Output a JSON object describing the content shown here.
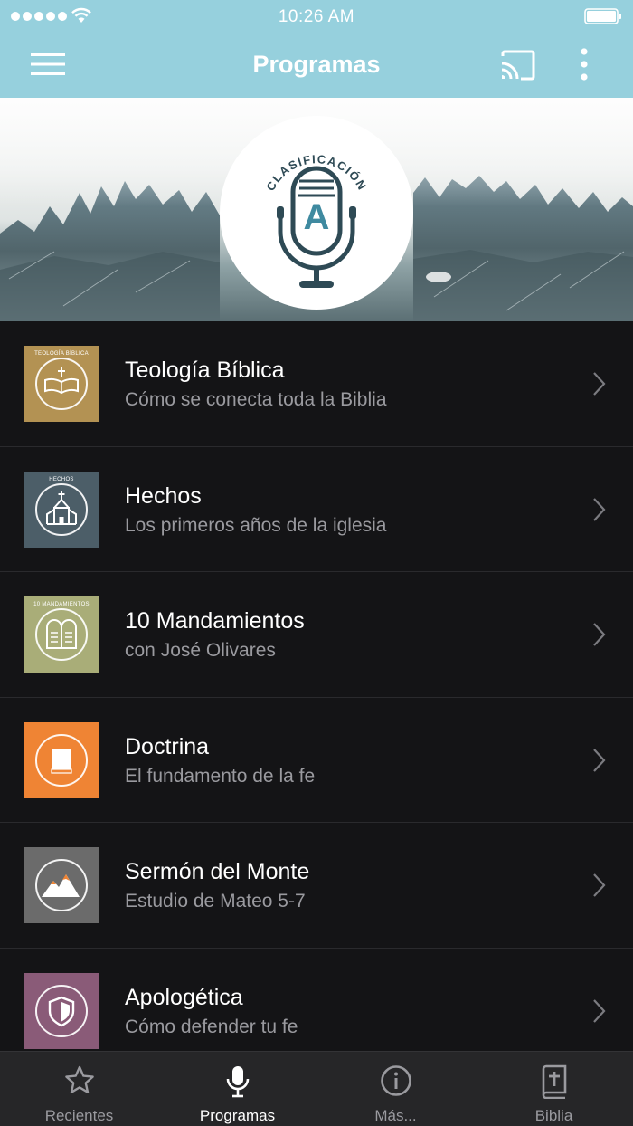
{
  "status_bar": {
    "time": "10:26 AM"
  },
  "nav": {
    "title": "Programas"
  },
  "hero": {
    "logo_text": "CLASIFICACIÓN",
    "logo_letter": "A"
  },
  "programs": [
    {
      "title": "Teología Bíblica",
      "subtitle": "Cómo se conecta toda la Biblia",
      "thumb_caption": "TEOLOGÍA BÍBLICA",
      "icon": "open-bible-icon",
      "color": "#b39253"
    },
    {
      "title": "Hechos",
      "subtitle": "Los primeros años de la iglesia",
      "thumb_caption": "HECHOS",
      "icon": "church-icon",
      "color": "#4c5e68"
    },
    {
      "title": "10 Mandamientos",
      "subtitle": "con José Olivares",
      "thumb_caption": "10 MANDAMIENTOS",
      "icon": "tablets-icon",
      "color": "#a9ad78"
    },
    {
      "title": "Doctrina",
      "subtitle": "El fundamento de la fe",
      "thumb_caption": "",
      "icon": "book-icon",
      "color": "#ef8434"
    },
    {
      "title": "Sermón del Monte",
      "subtitle": "Estudio de Mateo 5-7",
      "thumb_caption": "",
      "icon": "mountain-icon",
      "color": "#6b6b6b"
    },
    {
      "title": "Apologética",
      "subtitle": "Cómo defender tu fe",
      "thumb_caption": "",
      "icon": "shield-icon",
      "color": "#8a5b78"
    }
  ],
  "tabs": [
    {
      "label": "Recientes",
      "icon": "star-icon",
      "active": false
    },
    {
      "label": "Programas",
      "icon": "microphone-icon",
      "active": true
    },
    {
      "label": "Más...",
      "icon": "info-icon",
      "active": false
    },
    {
      "label": "Biblia",
      "icon": "bible-icon",
      "active": false
    }
  ],
  "colors": {
    "header": "#96d0dd",
    "background": "#141416",
    "tabbar": "#262628",
    "logo": "#2e4a55"
  }
}
